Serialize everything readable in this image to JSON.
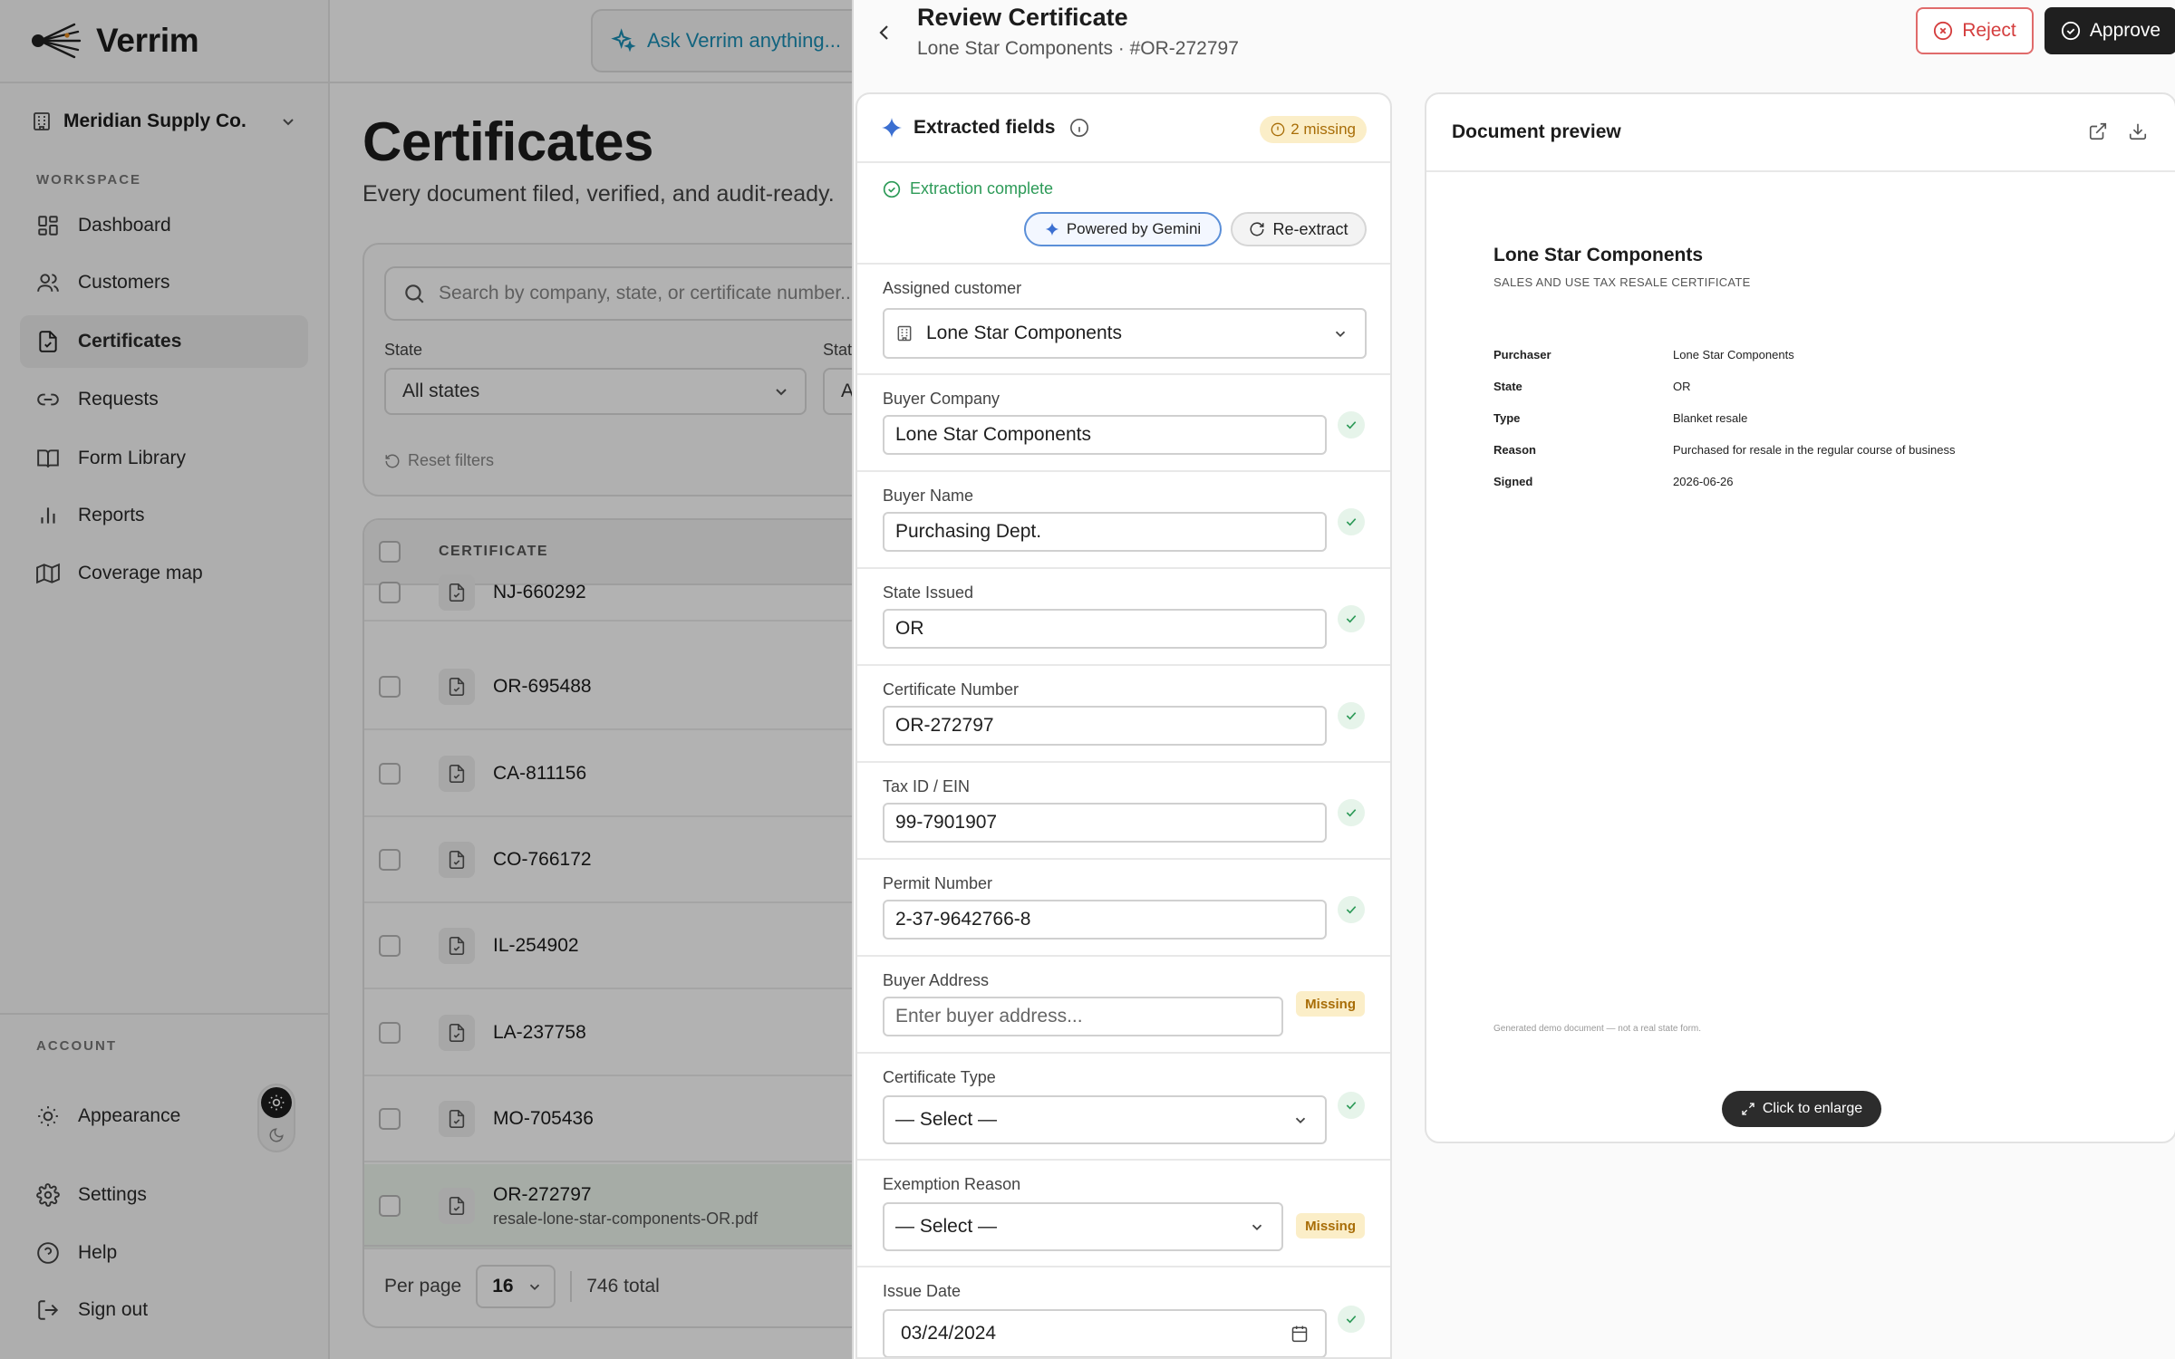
{
  "brand": {
    "name": "Verrim"
  },
  "sidebar": {
    "org": "Meridian Supply Co.",
    "workspace_label": "WORKSPACE",
    "items": [
      {
        "label": "Dashboard"
      },
      {
        "label": "Customers"
      },
      {
        "label": "Certificates"
      },
      {
        "label": "Requests"
      },
      {
        "label": "Form Library"
      },
      {
        "label": "Reports"
      },
      {
        "label": "Coverage map"
      }
    ],
    "account_label": "ACCOUNT",
    "account_items": [
      {
        "label": "Appearance"
      },
      {
        "label": "Settings"
      },
      {
        "label": "Help"
      },
      {
        "label": "Sign out"
      }
    ]
  },
  "topbar": {
    "ask_label": "Ask Verrim anything..."
  },
  "page": {
    "title": "Certificates",
    "subtitle": "Every document filed, verified, and audit-ready."
  },
  "filters": {
    "search_placeholder": "Search by company, state, or certificate number...",
    "state_label": "State",
    "state_value": "All states",
    "status_label": "Stat",
    "status_value": "A",
    "reset_label": "Reset filters"
  },
  "table": {
    "header": "CERTIFICATE",
    "rows": [
      {
        "name": "NJ-660292"
      },
      {
        "name": "OR-695488"
      },
      {
        "name": "CA-811156"
      },
      {
        "name": "CO-766172"
      },
      {
        "name": "IL-254902"
      },
      {
        "name": "LA-237758"
      },
      {
        "name": "MO-705436"
      },
      {
        "name": "OR-272797",
        "file": "resale-lone-star-components-OR.pdf"
      }
    ],
    "per_page_label": "Per page",
    "per_page_value": "16",
    "total": "746 total"
  },
  "panel": {
    "title": "Review Certificate",
    "subtitle": "Lone Star Components · #OR-272797",
    "reject_label": "Reject",
    "approve_label": "Approve"
  },
  "extracted": {
    "title": "Extracted fields",
    "missing_badge": "2 missing",
    "status": "Extraction complete",
    "gemini_label": "Powered by Gemini",
    "reextract_label": "Re-extract",
    "assigned_customer_label": "Assigned customer",
    "assigned_customer_value": "Lone Star Components",
    "fields": {
      "buyer_company": {
        "label": "Buyer Company",
        "value": "Lone Star Components"
      },
      "buyer_name": {
        "label": "Buyer Name",
        "value": "Purchasing Dept."
      },
      "state_issued": {
        "label": "State Issued",
        "value": "OR"
      },
      "certificate_number": {
        "label": "Certificate Number",
        "value": "OR-272797"
      },
      "tax_id": {
        "label": "Tax ID / EIN",
        "value": "99-7901907"
      },
      "permit_number": {
        "label": "Permit Number",
        "value": "2-37-9642766-8"
      },
      "buyer_address": {
        "label": "Buyer Address",
        "placeholder": "Enter buyer address...",
        "badge": "Missing"
      },
      "certificate_type": {
        "label": "Certificate Type",
        "value": "— Select —"
      },
      "exemption_reason": {
        "label": "Exemption Reason",
        "value": "— Select —",
        "badge": "Missing"
      },
      "issue_date": {
        "label": "Issue Date",
        "value": "03/24/2024"
      }
    }
  },
  "preview": {
    "title": "Document preview",
    "doc_company": "Lone Star Components",
    "doc_subtitle": "SALES AND USE TAX RESALE CERTIFICATE",
    "rows": [
      {
        "k": "Purchaser",
        "v": "Lone Star Components"
      },
      {
        "k": "State",
        "v": "OR"
      },
      {
        "k": "Type",
        "v": "Blanket resale"
      },
      {
        "k": "Reason",
        "v": "Purchased for resale in the regular course of business"
      },
      {
        "k": "Signed",
        "v": "2026-06-26"
      }
    ],
    "footer": "Generated demo document — not a real state form.",
    "enlarge_label": "Click to enlarge"
  },
  "colors": {
    "accent": "#1a8fb5",
    "success": "#2c9a57",
    "warning": "#a86d07",
    "danger": "#d43d3d",
    "gemini": "#3b6fd1"
  }
}
